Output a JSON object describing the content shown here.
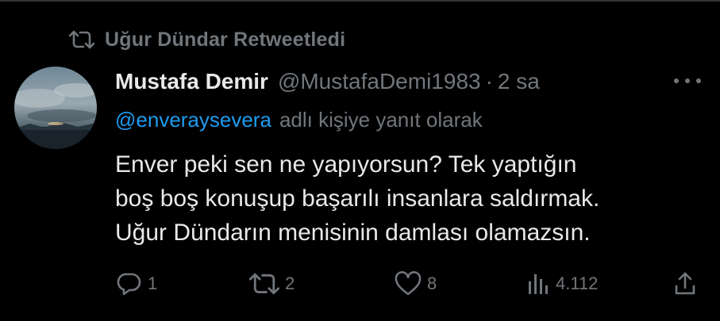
{
  "retweet": {
    "text": "Uğur Dündar Retweetledi",
    "icon": "retweet-icon"
  },
  "tweet": {
    "display_name": "Mustafa Demir",
    "handle": "@MustafaDemi1983",
    "separator": "·",
    "time": "2 sa",
    "more_icon": "more-horizontal-icon",
    "reply_to": {
      "mention": "@enveraysevera",
      "suffix": "adlı kişiye yanıt olarak"
    },
    "body_lines": [
      "Enver peki sen ne yapıyorsun? Tek yaptığın",
      "boş boş konuşup başarılı insanlara saldırmak.",
      "Uğur Dündarın menisinin damlası olamazsın."
    ]
  },
  "actions": {
    "reply": {
      "icon": "reply-icon",
      "count": "1"
    },
    "retweet": {
      "icon": "retweet-icon",
      "count": "2"
    },
    "like": {
      "icon": "heart-icon",
      "count": "8"
    },
    "views": {
      "icon": "views-icon",
      "count": "4.112"
    },
    "share": {
      "icon": "share-icon"
    }
  },
  "colors": {
    "background": "#000000",
    "primary_text": "#e7e9ea",
    "secondary_text": "#71767b",
    "link": "#1d9bf0"
  }
}
